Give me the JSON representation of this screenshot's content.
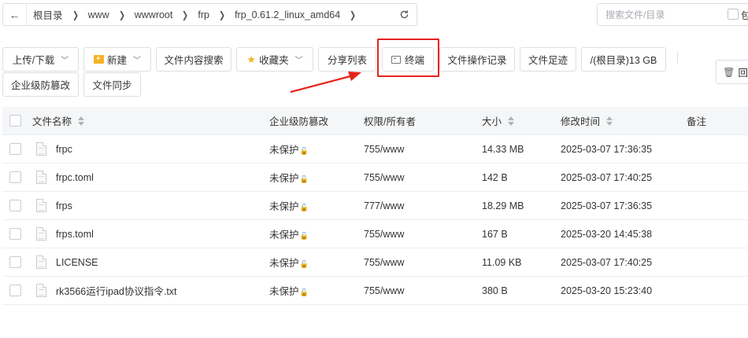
{
  "breadcrumb": {
    "items": [
      "根目录",
      "www",
      "wwwroot",
      "frp",
      "frp_0.61.2_linux_amd64"
    ],
    "sep": "❯"
  },
  "search": {
    "placeholder": "搜索文件/目录",
    "option_label": "包"
  },
  "toolbar": {
    "upload_label": "上传/下载",
    "new_label": "新建",
    "content_search_label": "文件内容搜索",
    "favorites_label": "收藏夹",
    "share_list_label": "分享列表",
    "terminal_label": "终端",
    "op_log_label": "文件操作记录",
    "footprint_label": "文件足迹",
    "disk_label": "/(根目录)13 GB",
    "tamper_label": "企业级防篡改",
    "sync_label": "文件同步",
    "recycle_label": "回"
  },
  "table": {
    "headers": {
      "name": "文件名称",
      "protect": "企业级防篡改",
      "perm": "权限/所有者",
      "size": "大小",
      "mtime": "修改时间",
      "note": "备注"
    },
    "rows": [
      {
        "name": "frpc",
        "protect": "未保护",
        "perm": "755/www",
        "size": "14.33 MB",
        "mtime": "2025-03-07 17:36:35"
      },
      {
        "name": "frpc.toml",
        "protect": "未保护",
        "perm": "755/www",
        "size": "142 B",
        "mtime": "2025-03-07 17:40:25"
      },
      {
        "name": "frps",
        "protect": "未保护",
        "perm": "777/www",
        "size": "18.29 MB",
        "mtime": "2025-03-07 17:36:35"
      },
      {
        "name": "frps.toml",
        "protect": "未保护",
        "perm": "755/www",
        "size": "167 B",
        "mtime": "2025-03-20 14:45:38"
      },
      {
        "name": "LICENSE",
        "protect": "未保护",
        "perm": "755/www",
        "size": "11.09 KB",
        "mtime": "2025-03-07 17:40:25"
      },
      {
        "name": "rk3566运行ipad协议指令.txt",
        "protect": "未保护",
        "perm": "755/www",
        "size": "380 B",
        "mtime": "2025-03-20 15:23:40"
      }
    ]
  },
  "colors": {
    "highlight": "#e8231d",
    "folder": "#f5b323"
  }
}
